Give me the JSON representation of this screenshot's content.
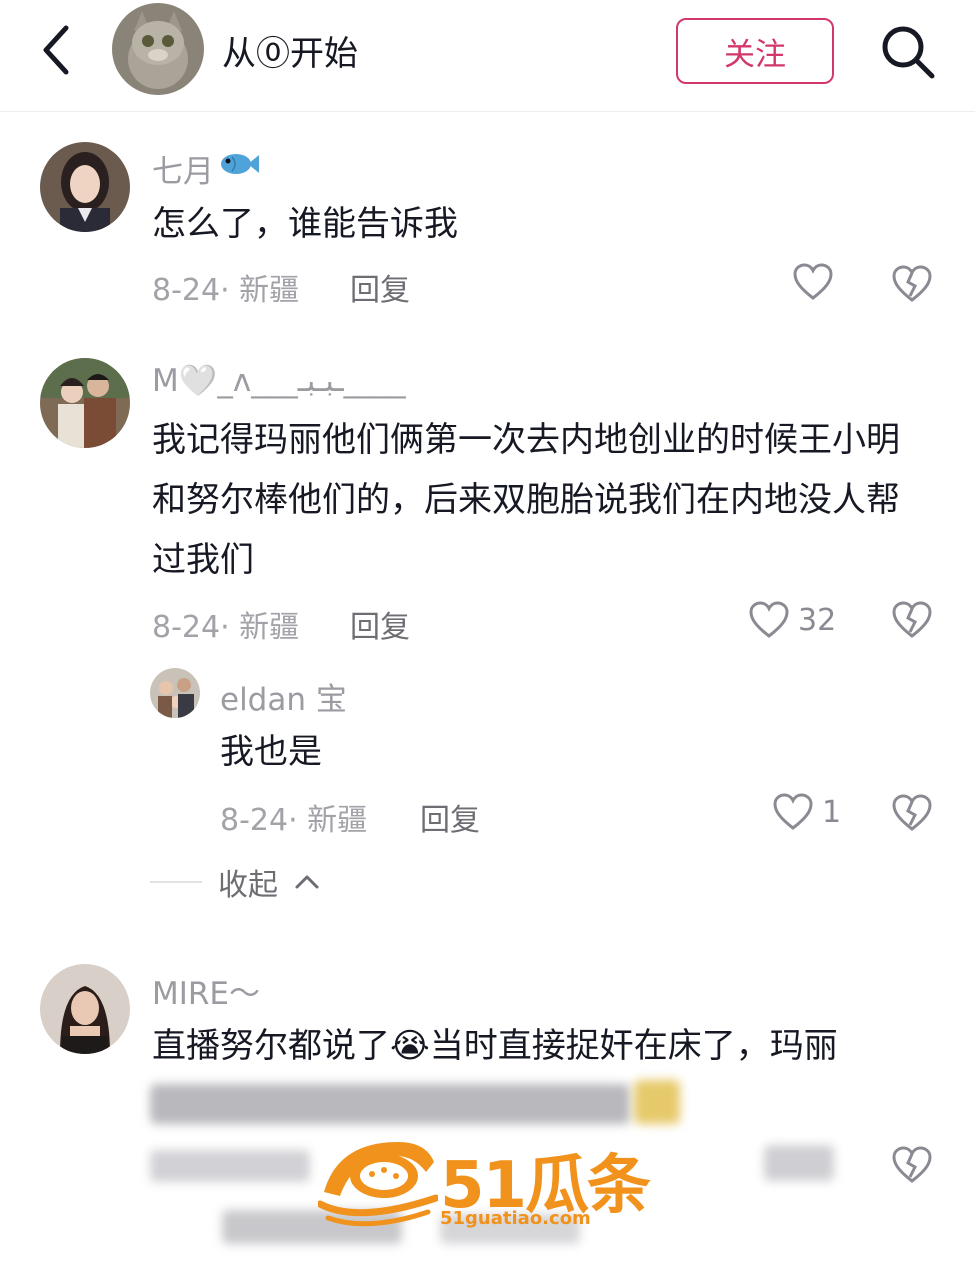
{
  "header": {
    "title": "从⓪开始",
    "follow_label": "关注"
  },
  "comments": [
    {
      "username": "七月",
      "text": "怎么了，谁能告诉我",
      "date_loc": "8-24· 新疆",
      "reply_label": "回复",
      "likes": ""
    },
    {
      "username": "M🤍_ʌ___ـبـبـ____",
      "text": "我记得玛丽他们俩第一次去内地创业的时候王小明和努尔棒他们的，后来双胞胎说我们在内地没人帮过我们",
      "date_loc": "8-24· 新疆",
      "reply_label": "回复",
      "likes": "32"
    },
    {
      "username": "MIRE～",
      "text": "直播努尔都说了😭当时直接捉奸在床了，玛丽",
      "date_loc": "8-24· 新疆",
      "reply_label": "回复",
      "likes": ""
    }
  ],
  "replies": [
    {
      "username": "eldan 宝",
      "text": "我也是",
      "date_loc": "8-24· 新疆",
      "reply_label": "回复",
      "likes": "1"
    }
  ],
  "collapse_label": "收起",
  "watermark": {
    "brand": "51瓜条",
    "url": "51guatiao.com"
  },
  "colors": {
    "follow": "#d2386a",
    "watermark": "#f0921c",
    "muted": "#a2a2a8"
  }
}
